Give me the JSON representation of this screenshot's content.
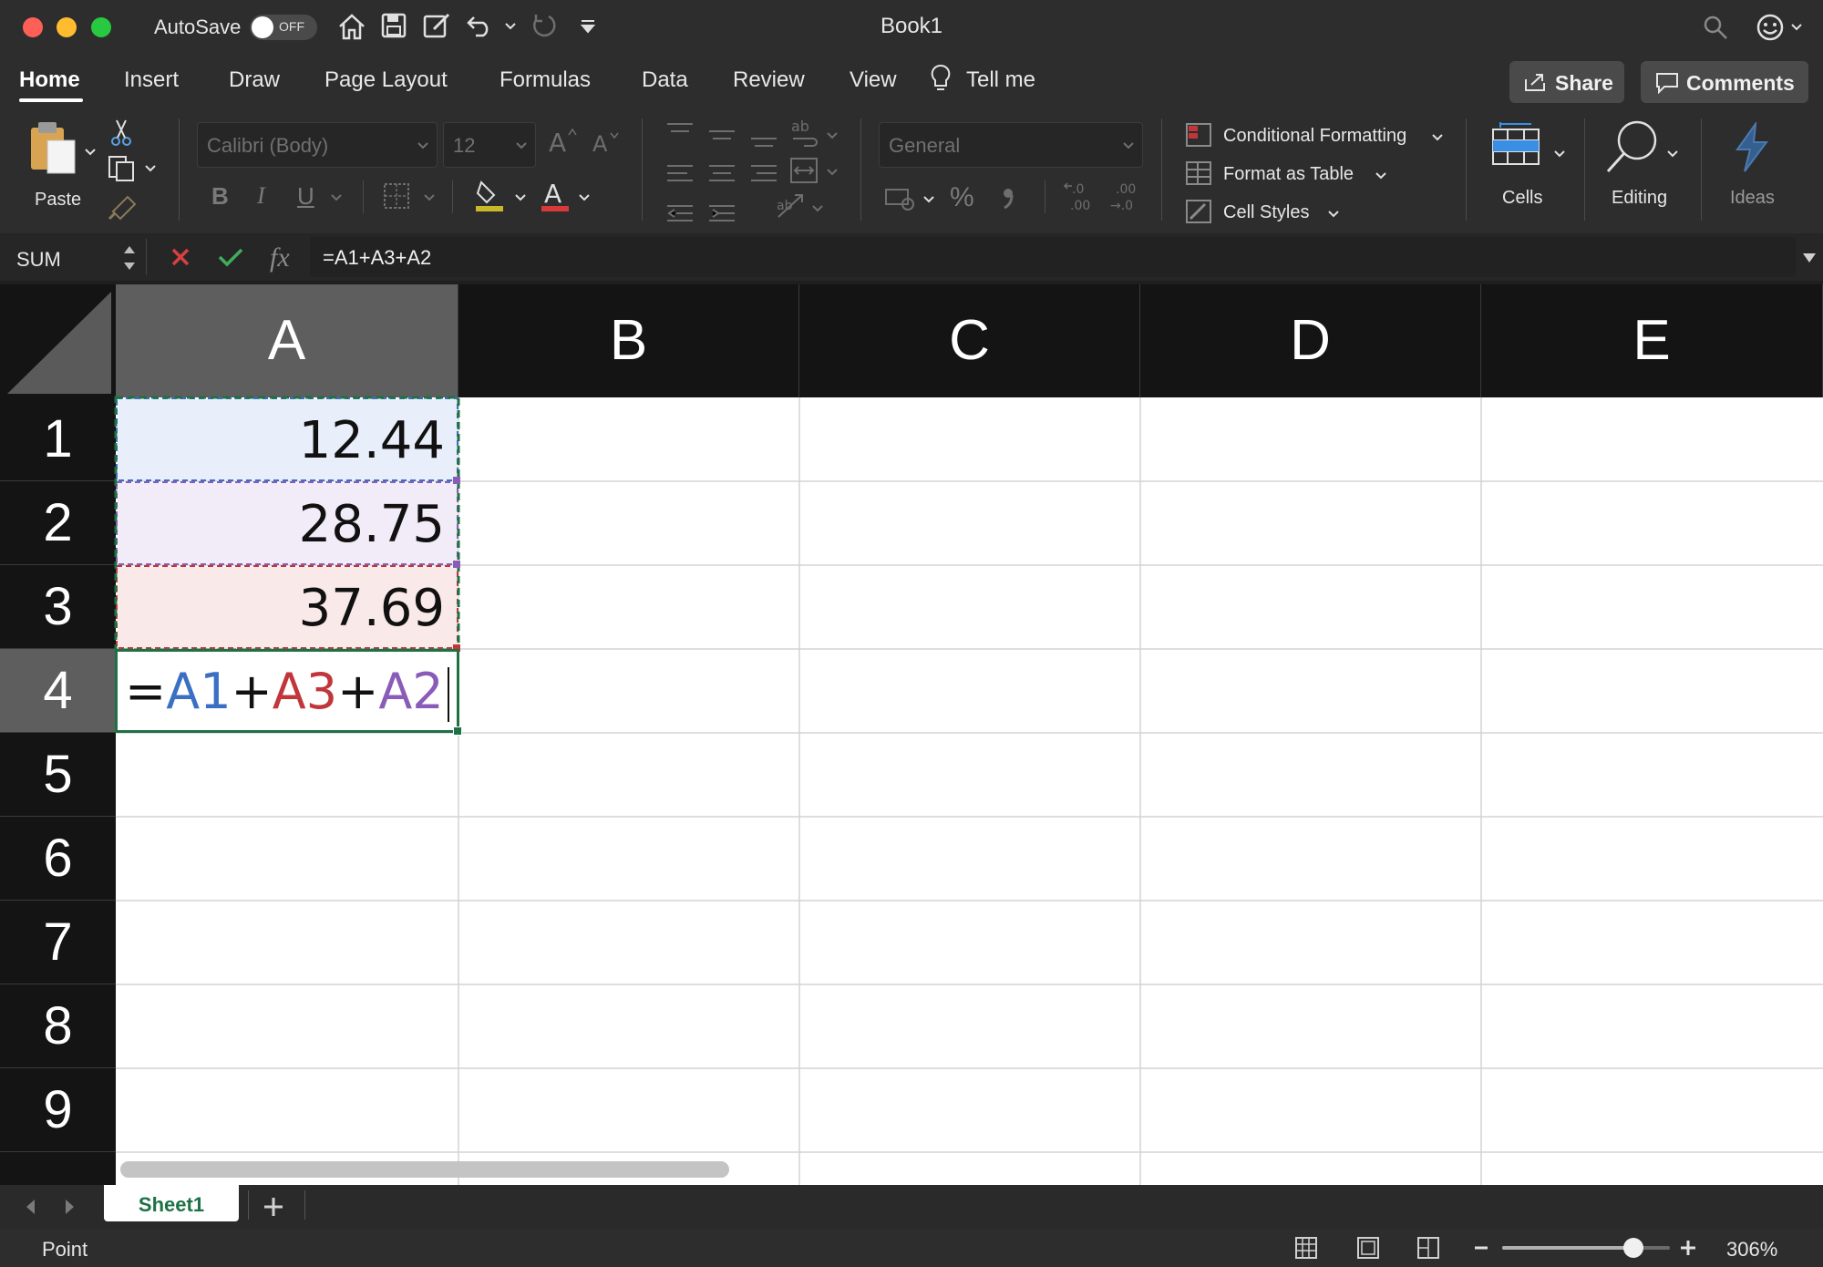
{
  "window": {
    "title": "Book1",
    "autosave_label": "AutoSave",
    "autosave_state": "OFF"
  },
  "tabs": [
    "Home",
    "Insert",
    "Draw",
    "Page Layout",
    "Formulas",
    "Data",
    "Review",
    "View"
  ],
  "tell_me": "Tell me",
  "share_label": "Share",
  "comments_label": "Comments",
  "ribbon": {
    "paste_label": "Paste",
    "font_name": "Calibri (Body)",
    "font_size": "12",
    "number_format": "General",
    "conditional_formatting": "Conditional Formatting",
    "format_as_table": "Format as Table",
    "cell_styles": "Cell Styles",
    "cells_label": "Cells",
    "editing_label": "Editing",
    "ideas_label": "Ideas",
    "bold": "B",
    "italic": "I",
    "underline": "U",
    "percent": "%",
    "comma": "̕"
  },
  "formula_bar": {
    "name_box": "SUM",
    "fx": "fx",
    "formula": "=A1+A3+A2"
  },
  "columns": [
    "A",
    "B",
    "C",
    "D",
    "E"
  ],
  "rows": [
    "1",
    "2",
    "3",
    "4",
    "5",
    "6",
    "7",
    "8",
    "9"
  ],
  "cells": {
    "A1": "12.44",
    "A2": "28.75",
    "A3": "37.69"
  },
  "edit_cell": {
    "eq": "=",
    "ref1": "A1",
    "op1": "+",
    "ref2": "A3",
    "op2": "+",
    "ref3": "A2"
  },
  "ref_colors": {
    "A1": "#3b6fc4",
    "A3": "#c0363b",
    "A2": "#8a5cb8",
    "sel": "#1e7145"
  },
  "sheets": [
    "Sheet1"
  ],
  "status": {
    "mode": "Point",
    "zoom": "306%",
    "zoom_level": 0.78
  }
}
